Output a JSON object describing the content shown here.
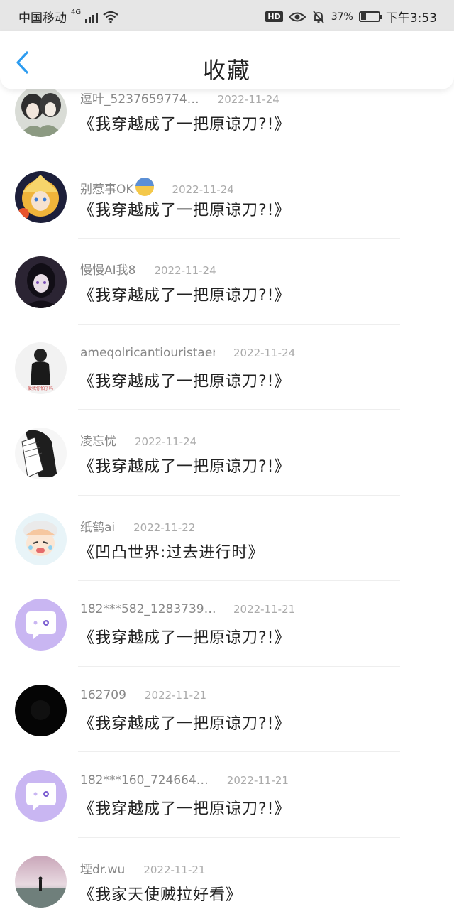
{
  "status_bar": {
    "carrier": "中国移动",
    "network_type": "4G",
    "battery_percent": "37%",
    "battery_level": 0.37,
    "time": "下午3:53",
    "icons": [
      "signal-icon",
      "wifi-icon",
      "hd-icon",
      "eye-icon",
      "mute-bell-icon",
      "battery-icon"
    ]
  },
  "header": {
    "title": "收藏",
    "back_icon": "chevron-left-icon",
    "accent_color": "#2d9cf0"
  },
  "items": [
    {
      "user": "逗叶_5237659774…",
      "date": "2022-11-24",
      "book": "《我穿越成了一把原谅刀?!》",
      "avatar": "anime-duo"
    },
    {
      "user": "别惹事OK",
      "emoji": "anxious-face-emoji",
      "date": "2022-11-24",
      "book": "《我穿越成了一把原谅刀?!》",
      "avatar": "anime-blonde"
    },
    {
      "user": "慢慢AI我8",
      "date": "2022-11-24",
      "book": "《我穿越成了一把原谅刀?!》",
      "avatar": "anime-dark"
    },
    {
      "user": "ameqolricantiouristaer",
      "date": "2022-11-24",
      "book": "《我穿越成了一把原谅刀?!》",
      "avatar": "photo-boy",
      "avatar_caption": "爱我你怕了吗"
    },
    {
      "user": "凌忘忧",
      "date": "2022-11-24",
      "book": "《我穿越成了一把原谅刀?!》",
      "avatar": "sketch-girl"
    },
    {
      "user": "纸鹤ai",
      "date": "2022-11-22",
      "book": "《凹凸世界:过去进行时》",
      "avatar": "anime-crying"
    },
    {
      "user": "182***582_1283739…",
      "date": "2022-11-21",
      "book": "《我穿越成了一把原谅刀?!》",
      "avatar": "default-chat"
    },
    {
      "user": "162709",
      "date": "2022-11-21",
      "book": "《我穿越成了一把原谅刀?!》",
      "avatar": "black"
    },
    {
      "user": "182***160_724664…",
      "date": "2022-11-21",
      "book": "《我穿越成了一把原谅刀?!》",
      "avatar": "default-chat"
    },
    {
      "user": "堙dr.wu",
      "date": "2022-11-21",
      "book": "《我家天使贼拉好看》",
      "avatar": "photo-sea"
    }
  ]
}
